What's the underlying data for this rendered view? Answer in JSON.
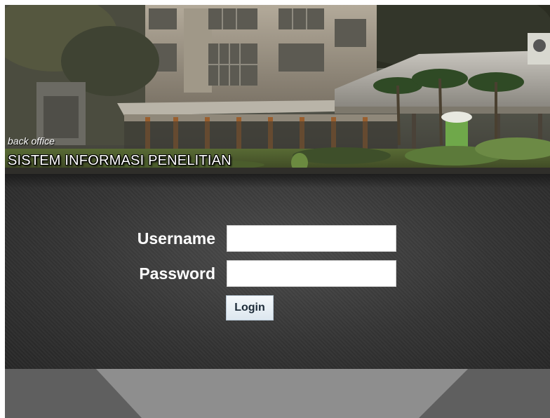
{
  "header": {
    "subtitle": "back office",
    "title": "SISTEM INFORMASI PENELITIAN"
  },
  "login_form": {
    "username_label": "Username",
    "username_value": "",
    "password_label": "Password",
    "password_value": "",
    "login_button_label": "Login"
  },
  "colors": {
    "panel_background": "#2f2f2f",
    "footer_background": "#7a7a7a",
    "button_background": "#e6eef5",
    "label_text": "#ffffff"
  }
}
